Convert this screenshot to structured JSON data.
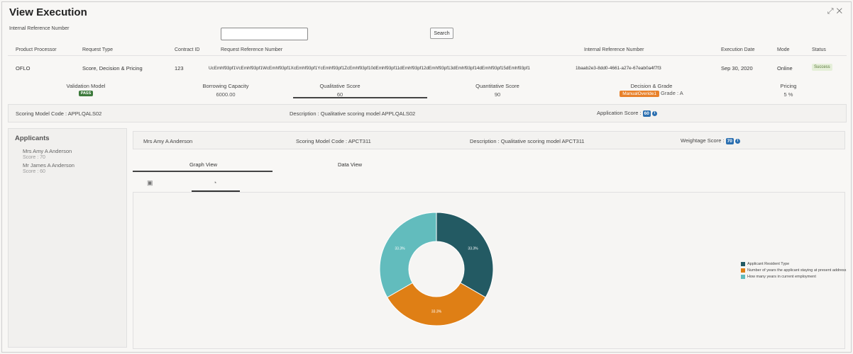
{
  "window": {
    "title": "View Execution",
    "expand_icon": "expand-icon",
    "close_icon": "close-icon"
  },
  "search": {
    "label": "Internal Reference Number",
    "value": "",
    "button": "Search"
  },
  "table": {
    "headers": {
      "product_processor": "Product Processor",
      "request_type": "Request Type",
      "contract_id": "Contract ID",
      "request_ref": "Request Reference Number",
      "internal_ref": "Internal Reference Number",
      "execution_date": "Execution Date",
      "mode": "Mode",
      "status": "Status"
    },
    "row": {
      "product_processor": "OFLO",
      "request_type": "Score, Decision & Pricing",
      "contract_id": "123",
      "request_ref": "UcEmhf93pf1VcEmhf93pf1WcEmhf93pf1XcEmhf93pf1YcEmhf93pf1ZcEmhf93pf10dEmhf93pf11dEmhf93pf12dEmhf93pf13dEmhf93pf14dEmhf93pf15dEmhf93pf1",
      "internal_ref": "1baab2e3-8dd0-4661-a27e-67eab0a4f7f3",
      "execution_date": "Sep 30, 2020",
      "mode": "Online",
      "status": "Success"
    }
  },
  "scores": {
    "validation_model": {
      "label": "Validation Model",
      "badge": "PASS"
    },
    "borrowing_capacity": {
      "label": "Borrowing Capacity",
      "value": "6000.00"
    },
    "qualitative_score": {
      "label": "Qualitative Score",
      "value": "60"
    },
    "quantitative_score": {
      "label": "Quantitative Score",
      "value": "90"
    },
    "decision_grade": {
      "label": "Decision & Grade",
      "decision": "ManualOveride1",
      "grade": "Grade : A"
    },
    "pricing": {
      "label": "Pricing",
      "value": "5 %"
    }
  },
  "model": {
    "code": "Scoring Model Code : APPLQALS02",
    "description": "Description : Qualitative scoring model APPLQALS02",
    "app_score_label": "Application Score :",
    "app_score": "60"
  },
  "applicants": {
    "title": "Applicants",
    "items": [
      {
        "name": "Mrs Amy A Anderson",
        "score": "Score : 70"
      },
      {
        "name": "Mr James A Anderson",
        "score": "Score : 60"
      }
    ]
  },
  "applicant_detail": {
    "name": "Mrs Amy A Anderson",
    "code": "Scoring Model Code : APCT311",
    "description": "Description : Qualitative scoring model APCT311",
    "weightage_label": "Weightage Score :",
    "weightage": "70"
  },
  "tabs": {
    "graph": "Graph View",
    "data": "Data View"
  },
  "mini_icons": {
    "table": "table-icon",
    "chart": "pie-chart-icon"
  },
  "chart_data": {
    "type": "pie",
    "donut": true,
    "title": "",
    "series": [
      {
        "name": "Applicant Resident Type",
        "value": 33.3,
        "label": "33.3%",
        "color": "#235a63"
      },
      {
        "name": "Number of years the applicant staying at present address",
        "value": 33.3,
        "label": "33.3%",
        "color": "#df7f15"
      },
      {
        "name": "How many years in current employment",
        "value": 33.3,
        "label": "33.3%",
        "color": "#62bcbd"
      }
    ],
    "legend_position": "right"
  }
}
